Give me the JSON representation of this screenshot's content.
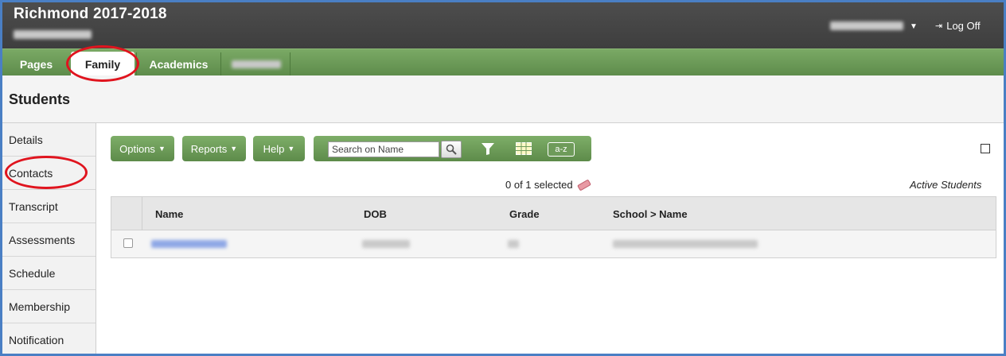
{
  "header": {
    "title": "Richmond 2017-2018",
    "logoff_label": "Log Off"
  },
  "tabs": [
    {
      "label": "Pages"
    },
    {
      "label": "Family"
    },
    {
      "label": "Academics"
    }
  ],
  "page": {
    "title": "Students"
  },
  "sidenav": {
    "items": [
      {
        "label": "Details"
      },
      {
        "label": "Contacts"
      },
      {
        "label": "Transcript"
      },
      {
        "label": "Assessments"
      },
      {
        "label": "Schedule"
      },
      {
        "label": "Membership"
      },
      {
        "label": "Notification"
      }
    ]
  },
  "toolbar": {
    "options_label": "Options",
    "reports_label": "Reports",
    "help_label": "Help",
    "search_placeholder": "Search on Name",
    "sort_label": "a-z"
  },
  "list": {
    "selected_count": "0 of 1 selected",
    "filter_label": "Active Students",
    "columns": [
      "Name",
      "DOB",
      "Grade",
      "School > Name"
    ]
  },
  "colors": {
    "header_bg": "#444444",
    "tab_green": "#6a9a55",
    "link_blue": "#2a5bd7",
    "annotation_red": "#e0141e"
  }
}
